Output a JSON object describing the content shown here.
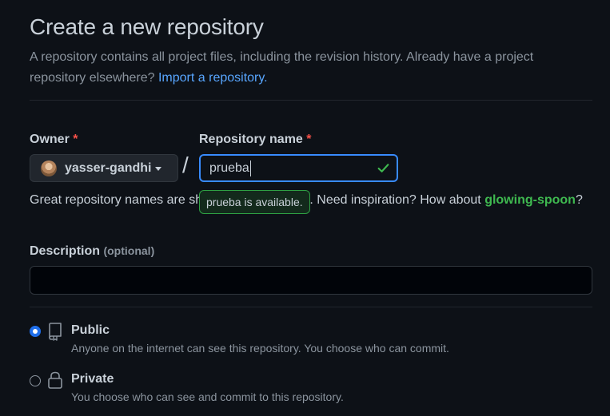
{
  "header": {
    "title": "Create a new repository",
    "subtitle_text": "A repository contains all project files, including the revision history. Already have a project repository elsewhere?",
    "import_link": "Import a repository."
  },
  "owner": {
    "label": "Owner",
    "required_mark": "*",
    "value": "yasser-gandhi"
  },
  "separator": "/",
  "repo_name": {
    "label": "Repository name",
    "required_mark": "*",
    "value": "prueba",
    "tooltip": "prueba is available."
  },
  "hint": {
    "text_before": "Great repository names are short and memorable. Need inspiration? How about",
    "suggestion": "glowing-spoon",
    "text_after": "?"
  },
  "description": {
    "label": "Description",
    "optional": "(optional)",
    "value": ""
  },
  "visibility": {
    "selected": "public",
    "options": [
      {
        "id": "public",
        "title": "Public",
        "desc": "Anyone on the internet can see this repository. You choose who can commit."
      },
      {
        "id": "private",
        "title": "Private",
        "desc": "You choose who can see and commit to this repository."
      }
    ]
  },
  "colors": {
    "accent": "#58a6ff",
    "success": "#3fb950",
    "danger": "#f85149",
    "background": "#0d1117"
  },
  "icons": {
    "public": "repo-icon",
    "private": "lock-icon",
    "available": "check-icon",
    "dropdown": "triangle-down-icon"
  }
}
